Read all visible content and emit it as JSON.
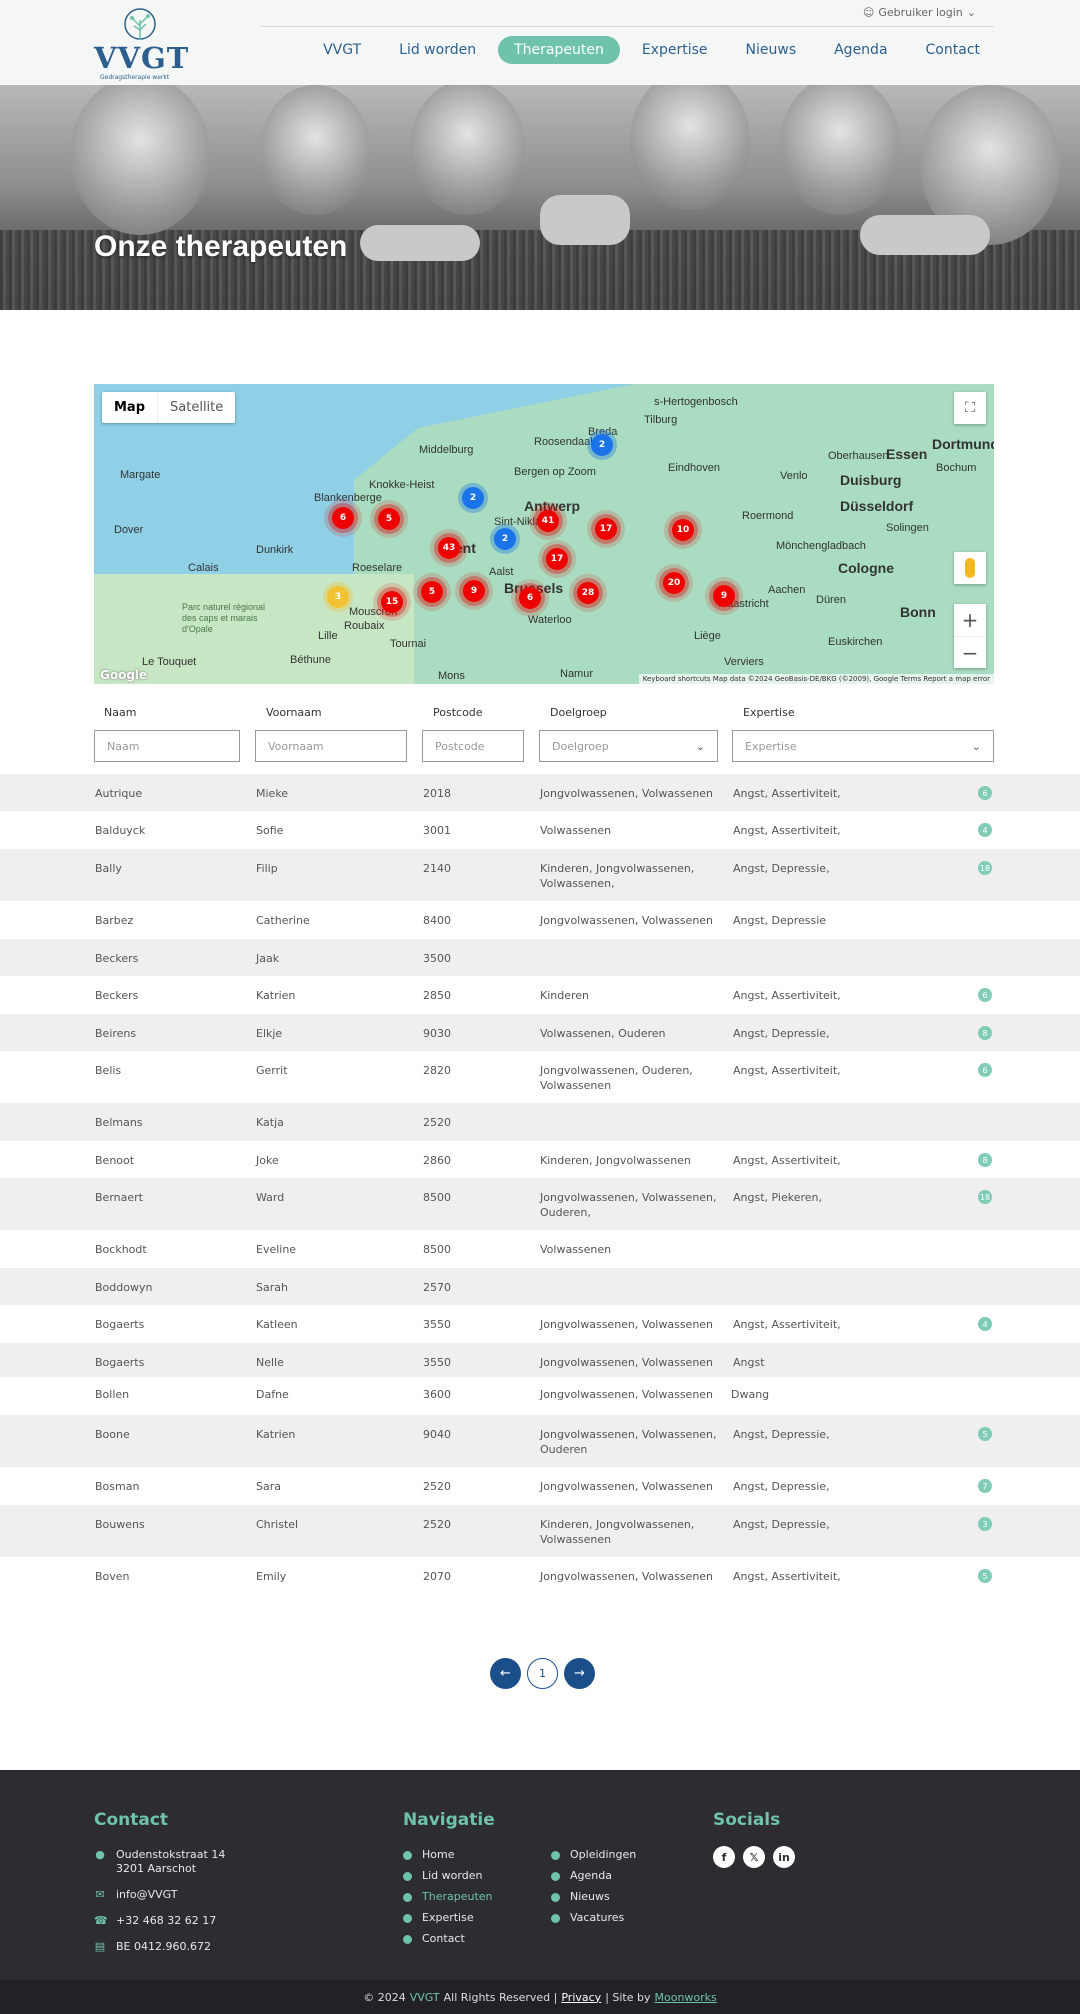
{
  "header": {
    "logo": {
      "wordmark": "VVGT",
      "tagline": "Gedragstherapie werkt"
    },
    "user_login": "Gebruiker login",
    "nav": [
      {
        "label": "VVGT",
        "active": false
      },
      {
        "label": "Lid worden",
        "active": false
      },
      {
        "label": "Therapeuten",
        "active": true
      },
      {
        "label": "Expertise",
        "active": false
      },
      {
        "label": "Nieuws",
        "active": false
      },
      {
        "label": "Agenda",
        "active": false
      },
      {
        "label": "Contact",
        "active": false
      }
    ]
  },
  "hero": {
    "title": "Onze therapeuten"
  },
  "map": {
    "tab_map": "Map",
    "tab_satellite": "Satellite",
    "attribution": "Keyboard shortcuts   Map data ©2024 GeoBasis-DE/BKG (©2009), Google   Terms   Report a map error",
    "google": "Google",
    "cities": [
      "Antwerp",
      "Brussels",
      "Duisburg",
      "Düsseldorf",
      "Cologne",
      "Essen",
      "Dortmund",
      "Bonn",
      "Eindhoven",
      "Breda",
      "Tilburg",
      "Middelburg",
      "Roosendaal",
      "Calais",
      "Dunkirk",
      "Lille",
      "Roubaix",
      "Tournai",
      "Mons",
      "Namur",
      "Liège",
      "Maastricht",
      "Aachen",
      "Gent",
      "Knokke-Heist",
      "Blankenberge",
      "Roeselare",
      "Aalst",
      "Waterloo",
      "Roermond",
      "Venlo",
      "Mönchengladbach",
      "Solingen",
      "Düren",
      "Euskirchen",
      "Verviers",
      "Margate",
      "Dover",
      "Le Touquet",
      "Béthune",
      "Mouscron",
      "s-Hertogenbosch",
      "Oberhausen",
      "Bochum",
      "Sint-Niklaas",
      "Bergen op Zoom",
      "Parc naturel régional des caps et marais d'Opale"
    ],
    "clusters": [
      {
        "count": "6",
        "color": "red"
      },
      {
        "count": "5",
        "color": "red"
      },
      {
        "count": "43",
        "color": "red"
      },
      {
        "count": "41",
        "color": "red"
      },
      {
        "count": "17",
        "color": "red"
      },
      {
        "count": "17",
        "color": "red"
      },
      {
        "count": "10",
        "color": "red"
      },
      {
        "count": "15",
        "color": "red"
      },
      {
        "count": "5",
        "color": "red"
      },
      {
        "count": "9",
        "color": "red"
      },
      {
        "count": "6",
        "color": "red"
      },
      {
        "count": "28",
        "color": "red"
      },
      {
        "count": "20",
        "color": "red"
      },
      {
        "count": "9",
        "color": "red"
      },
      {
        "count": "2",
        "color": "blue"
      },
      {
        "count": "2",
        "color": "blue"
      },
      {
        "count": "2",
        "color": "blue"
      },
      {
        "count": "3",
        "color": "yellow"
      }
    ]
  },
  "filters": {
    "naam_label": "Naam",
    "naam_placeholder": "Naam",
    "voornaam_label": "Voornaam",
    "voornaam_placeholder": "Voornaam",
    "postcode_label": "Postcode",
    "postcode_placeholder": "Postcode",
    "doelgroep_label": "Doelgroep",
    "doelgroep_placeholder": "Doelgroep",
    "expertise_label": "Expertise",
    "expertise_placeholder": "Expertise"
  },
  "therapists": [
    {
      "naam": "Autrique",
      "voornaam": "Mieke",
      "postcode": "2018",
      "doelgroep": "Jongvolwassenen, Volwassenen",
      "expertise": "Angst, Assertiviteit,",
      "badge": "6"
    },
    {
      "naam": "Balduyck",
      "voornaam": "Sofie",
      "postcode": "3001",
      "doelgroep": "Volwassenen",
      "expertise": "Angst, Assertiviteit,",
      "badge": "4"
    },
    {
      "naam": "Bally",
      "voornaam": "Filip",
      "postcode": "2140",
      "doelgroep": "Kinderen, Jongvolwassenen, Volwassenen,",
      "expertise": "Angst, Depressie,",
      "badge": "18"
    },
    {
      "naam": "Barbez",
      "voornaam": "Catherine",
      "postcode": "8400",
      "doelgroep": "Jongvolwassenen, Volwassenen",
      "expertise": "Angst, Depressie",
      "badge": ""
    },
    {
      "naam": "Beckers",
      "voornaam": "Jaak",
      "postcode": "3500",
      "doelgroep": "",
      "expertise": "",
      "badge": ""
    },
    {
      "naam": "Beckers",
      "voornaam": "Katrien",
      "postcode": "2850",
      "doelgroep": "Kinderen",
      "expertise": "Angst, Assertiviteit,",
      "badge": "6"
    },
    {
      "naam": "Beirens",
      "voornaam": "Elkje",
      "postcode": "9030",
      "doelgroep": "Volwassenen, Ouderen",
      "expertise": "Angst, Depressie,",
      "badge": "8"
    },
    {
      "naam": "Belis",
      "voornaam": "Gerrit",
      "postcode": "2820",
      "doelgroep": "Jongvolwassenen, Ouderen, Volwassenen",
      "expertise": "Angst, Assertiviteit,",
      "badge": "6"
    },
    {
      "naam": "Belmans",
      "voornaam": "Katja",
      "postcode": "2520",
      "doelgroep": "",
      "expertise": "",
      "badge": ""
    },
    {
      "naam": "Benoot",
      "voornaam": "Joke",
      "postcode": "2860",
      "doelgroep": "Kinderen, Jongvolwassenen",
      "expertise": "Angst, Assertiviteit,",
      "badge": "8"
    },
    {
      "naam": "Bernaert",
      "voornaam": "Ward",
      "postcode": "8500",
      "doelgroep": "Jongvolwassenen, Volwassenen, Ouderen,",
      "expertise": "Angst, Piekeren,",
      "badge": "18"
    },
    {
      "naam": "Bockhodt",
      "voornaam": "Eveline",
      "postcode": "8500",
      "doelgroep": "Volwassenen",
      "expertise": "",
      "badge": ""
    },
    {
      "naam": "Boddowyn",
      "voornaam": "Sarah",
      "postcode": "2570",
      "doelgroep": "",
      "expertise": "",
      "badge": ""
    },
    {
      "naam": "Bogaerts",
      "voornaam": "Katleen",
      "postcode": "3550",
      "doelgroep": "Jongvolwassenen, Volwassenen",
      "expertise": "Angst, Assertiviteit,",
      "badge": "4"
    },
    {
      "naam": "Bogaerts",
      "voornaam": "Nelle",
      "postcode": "3550",
      "doelgroep": "Jongvolwassenen, Volwassenen",
      "expertise": "Angst",
      "badge": ""
    },
    {
      "naam": "Bollen",
      "voornaam": "Dafne",
      "postcode": "3600",
      "doelgroep": "Jongvolwassenen, Volwassenen",
      "expertise": "Dwang",
      "badge": ""
    },
    {
      "naam": "Boone",
      "voornaam": "Katrien",
      "postcode": "9040",
      "doelgroep": "Jongvolwassenen, Volwassenen, Ouderen",
      "expertise": "Angst, Depressie,",
      "badge": "5"
    },
    {
      "naam": "Bosman",
      "voornaam": "Sara",
      "postcode": "2520",
      "doelgroep": "Jongvolwassenen, Volwassenen",
      "expertise": "Angst, Depressie,",
      "badge": "7"
    },
    {
      "naam": "Bouwens",
      "voornaam": "Christel",
      "postcode": "2520",
      "doelgroep": "Kinderen, Jongvolwassenen, Volwassenen",
      "expertise": "Angst, Depressie,",
      "badge": "3"
    },
    {
      "naam": "Boven",
      "voornaam": "Emily",
      "postcode": "2070",
      "doelgroep": "Jongvolwassenen, Volwassenen",
      "expertise": "Angst, Assertiviteit,",
      "badge": "5"
    }
  ],
  "pagination": {
    "current_page": "1"
  },
  "footer": {
    "contact_title": "Contact",
    "address_line1": "Oudenstokstraat 14",
    "address_line2": "3201 Aarschot",
    "email": "info@VVGT",
    "phone": "+32 468 32 62 17",
    "vat": "BE 0412.960.672",
    "nav_title": "Navigatie",
    "nav_col1": [
      "Home",
      "Lid worden",
      "Therapeuten",
      "Expertise",
      "Contact"
    ],
    "nav_col2": [
      "Opleidingen",
      "Agenda",
      "Nieuws",
      "Vacatures"
    ],
    "socials_title": "Socials",
    "copyright_prefix": "© 2024",
    "copyright_brand": "VVGT",
    "copyright_suffix": "All Rights Reserved |",
    "privacy": "Privacy",
    "site_by": "| Site by",
    "agency": "Moonworks"
  },
  "colors": {
    "accent": "#6fc2ac",
    "brand_blue": "#2c5f8d",
    "pager_blue": "#1b4f8a",
    "footer_bg": "#2d2c31"
  }
}
